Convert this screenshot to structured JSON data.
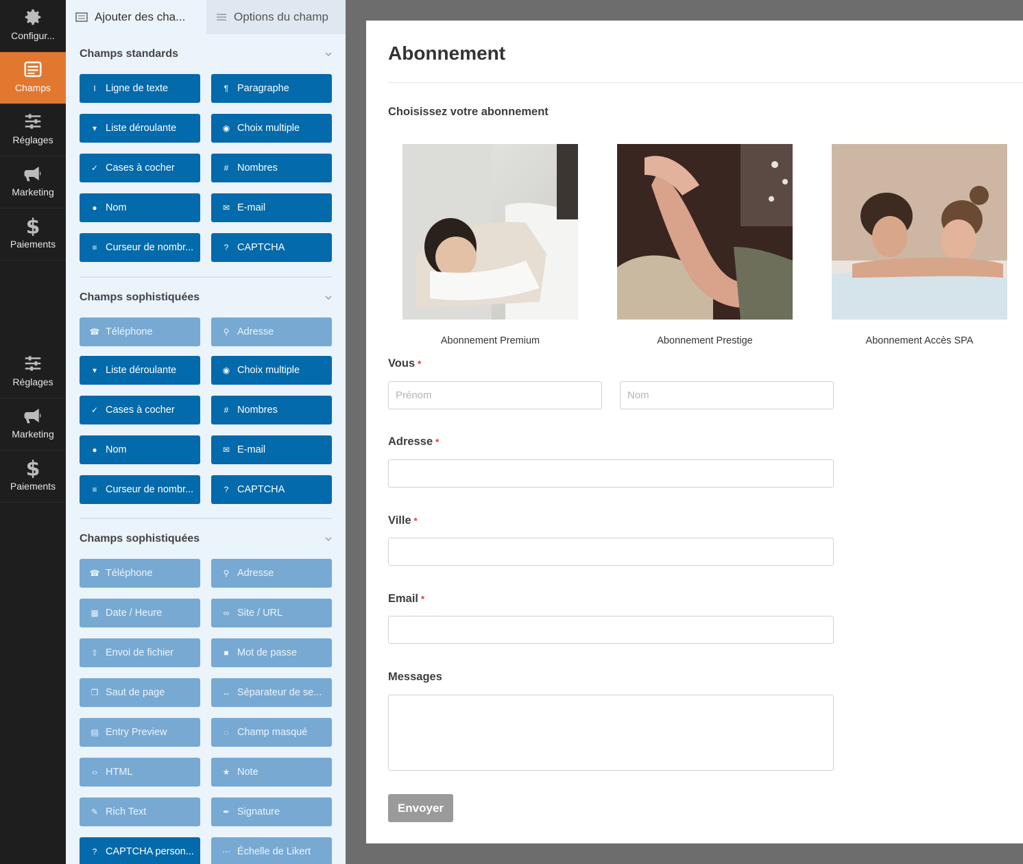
{
  "nav": [
    {
      "label": "Configur...",
      "icon": "gear-icon"
    },
    {
      "label": "Champs",
      "icon": "fields-list-icon",
      "active": true
    },
    {
      "label": "Réglages",
      "icon": "sliders-icon"
    },
    {
      "label": "Marketing",
      "icon": "megaphone-icon"
    },
    {
      "label": "Paiements",
      "icon": "dollar-icon"
    },
    {
      "label": "Réglages",
      "icon": "sliders-icon"
    },
    {
      "label": "Marketing",
      "icon": "megaphone-icon"
    },
    {
      "label": "Paiements",
      "icon": "dollar-icon"
    }
  ],
  "panel": {
    "tabs": {
      "add_fields": "Ajouter des cha...",
      "field_options": "Options du champ"
    },
    "sections": [
      {
        "title": "Champs standards",
        "fields": [
          {
            "label": "Ligne de texte",
            "icon": "text-cursor-icon"
          },
          {
            "label": "Paragraphe",
            "icon": "paragraph-icon"
          },
          {
            "label": "Liste déroulante",
            "icon": "dropdown-icon"
          },
          {
            "label": "Choix multiple",
            "icon": "radio-icon"
          },
          {
            "label": "Cases à cocher",
            "icon": "checkbox-icon"
          },
          {
            "label": "Nombres",
            "icon": "hash-icon"
          },
          {
            "label": "Nom",
            "icon": "user-icon"
          },
          {
            "label": "E-mail",
            "icon": "envelope-icon"
          },
          {
            "label": "Curseur de nombr...",
            "icon": "slider-icon"
          },
          {
            "label": "CAPTCHA",
            "icon": "question-circle-icon"
          }
        ]
      },
      {
        "title": "Champs sophistiquées",
        "fields": [
          {
            "label": "Téléphone",
            "icon": "phone-icon",
            "disabled": true
          },
          {
            "label": "Adresse",
            "icon": "map-pin-icon",
            "disabled": true
          },
          {
            "label": "Liste déroulante",
            "icon": "dropdown-icon"
          },
          {
            "label": "Choix multiple",
            "icon": "radio-icon"
          },
          {
            "label": "Cases à cocher",
            "icon": "checkbox-icon"
          },
          {
            "label": "Nombres",
            "icon": "hash-icon"
          },
          {
            "label": "Nom",
            "icon": "user-icon"
          },
          {
            "label": "E-mail",
            "icon": "envelope-icon"
          },
          {
            "label": "Curseur de nombr...",
            "icon": "slider-icon"
          },
          {
            "label": "CAPTCHA",
            "icon": "question-circle-icon"
          }
        ]
      },
      {
        "title": "Champs sophistiquées",
        "fields": [
          {
            "label": "Téléphone",
            "icon": "phone-icon",
            "disabled": true
          },
          {
            "label": "Adresse",
            "icon": "map-pin-icon",
            "disabled": true
          },
          {
            "label": "Date / Heure",
            "icon": "calendar-icon",
            "disabled": true
          },
          {
            "label": "Site / URL",
            "icon": "link-icon",
            "disabled": true
          },
          {
            "label": "Envoi de fichier",
            "icon": "upload-icon",
            "disabled": true
          },
          {
            "label": "Mot de passe",
            "icon": "lock-icon",
            "disabled": true
          },
          {
            "label": "Saut de page",
            "icon": "copy-icon",
            "disabled": true
          },
          {
            "label": "Séparateur de se...",
            "icon": "arrows-h-icon",
            "disabled": true
          },
          {
            "label": "Entry Preview",
            "icon": "file-icon",
            "disabled": true
          },
          {
            "label": "Champ masqué",
            "icon": "eye-slash-icon",
            "disabled": true
          },
          {
            "label": "HTML",
            "icon": "code-icon",
            "disabled": true
          },
          {
            "label": "Note",
            "icon": "star-icon",
            "disabled": true
          },
          {
            "label": "Rich Text",
            "icon": "edit-icon",
            "disabled": true
          },
          {
            "label": "Signature",
            "icon": "pen-icon",
            "disabled": true
          },
          {
            "label": "CAPTCHA person...",
            "icon": "question-circle-icon"
          },
          {
            "label": "Échelle de Likert",
            "icon": "dots-icon",
            "disabled": true
          }
        ]
      }
    ]
  },
  "form": {
    "title": "Abonnement",
    "choose_label": "Choisissez votre abonnement",
    "choices": [
      {
        "caption": "Abonnement Premium"
      },
      {
        "caption": "Abonnement Prestige"
      },
      {
        "caption": "Abonnement Accès SPA"
      }
    ],
    "vous_label": "Vous",
    "firstname_placeholder": "Prénom",
    "lastname_placeholder": "Nom",
    "address_label": "Adresse",
    "city_label": "Ville",
    "email_label": "Email",
    "messages_label": "Messages",
    "required_mark": "*",
    "submit_label": "Envoyer"
  },
  "colors": {
    "accent_orange": "#e27730",
    "field_blue": "#036aab",
    "field_blue_disabled": "#77a9d3",
    "required_red": "#d63638"
  }
}
